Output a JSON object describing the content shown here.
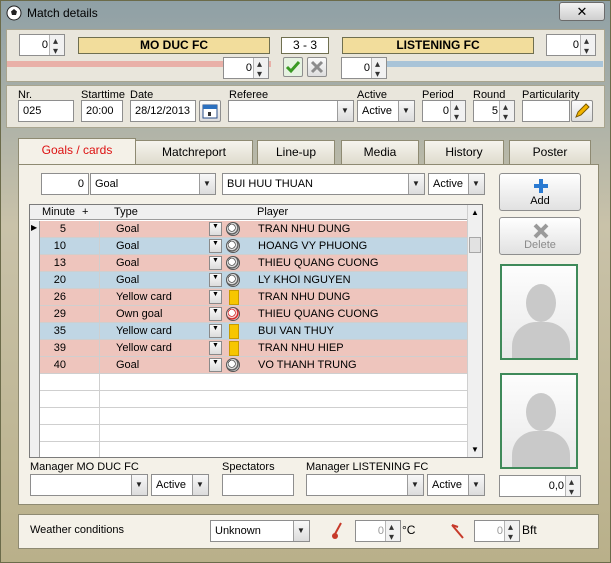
{
  "window": {
    "title": "Match details",
    "close_label": "✕"
  },
  "score_bar": {
    "left_spin": "0",
    "home_team": "MO DUC FC",
    "score": "3  - 3",
    "away_team": "LISTENING FC",
    "right_spin": "0",
    "home_extra": "0",
    "away_extra": "0",
    "home_color": "#e9b0a8",
    "away_color": "#a9c4d8"
  },
  "match_info": {
    "nr_label": "Nr.",
    "nr_value": "025",
    "starttime_label": "Starttime",
    "starttime_value": "20:00",
    "date_label": "Date",
    "date_value": "28/12/2013",
    "referee_label": "Referee",
    "referee_value": "",
    "active_label": "Active",
    "active_value": "Active",
    "period_label": "Period",
    "period_value": "0",
    "round_label": "Round",
    "round_value": "5",
    "particularity_label": "Particularity",
    "particularity_value": ""
  },
  "tabs": [
    {
      "label": "Goals / cards",
      "active": true
    },
    {
      "label": "Matchreport"
    },
    {
      "label": "Line-up"
    },
    {
      "label": "Media"
    },
    {
      "label": "History"
    },
    {
      "label": "Poster"
    }
  ],
  "event_entry": {
    "minute": "0",
    "type": "Goal",
    "player": "BUI HUU THUAN",
    "status": "Active"
  },
  "grid": {
    "columns": {
      "minute": "Minute",
      "plus": "+",
      "type": "Type",
      "player": "Player"
    },
    "rows": [
      {
        "minute": "5",
        "type": "Goal",
        "player": "TRAN NHU DUNG",
        "team": "home",
        "icon": "ball-icon"
      },
      {
        "minute": "10",
        "type": "Goal",
        "player": "HOANG VY PHUONG",
        "team": "away",
        "icon": "ball-icon"
      },
      {
        "minute": "13",
        "type": "Goal",
        "player": "THIEU QUANG CUONG",
        "team": "home",
        "icon": "ball-icon"
      },
      {
        "minute": "20",
        "type": "Goal",
        "player": "LY KHOI NGUYEN",
        "team": "away",
        "icon": "ball-icon"
      },
      {
        "minute": "26",
        "type": "Yellow card",
        "player": "TRAN NHU DUNG",
        "team": "home",
        "icon": "yellow-card-icon"
      },
      {
        "minute": "29",
        "type": "Own goal",
        "player": "THIEU QUANG CUONG",
        "team": "home",
        "icon": "own-goal-ball-icon"
      },
      {
        "minute": "35",
        "type": "Yellow card",
        "player": "BUI VAN THUY",
        "team": "away",
        "icon": "yellow-card-icon"
      },
      {
        "minute": "39",
        "type": "Yellow card",
        "player": "TRAN NHU HIEP",
        "team": "home",
        "icon": "yellow-card-icon"
      },
      {
        "minute": "40",
        "type": "Goal",
        "player": "VO THANH TRUNG",
        "team": "home",
        "icon": "ball-icon"
      }
    ]
  },
  "side_buttons": {
    "add_label": "Add",
    "delete_label": "Delete"
  },
  "bottom": {
    "manager_home_label": "Manager MO DUC FC",
    "manager_home_status": "Active",
    "spectators_label": "Spectators",
    "manager_away_label": "Manager LISTENING FC",
    "manager_away_status": "Active",
    "rating_value": "0,0"
  },
  "weather": {
    "label": "Weather conditions",
    "condition": "Unknown",
    "temperature": "0",
    "temp_unit": "°C",
    "wind": "0",
    "wind_unit": "Bft"
  }
}
